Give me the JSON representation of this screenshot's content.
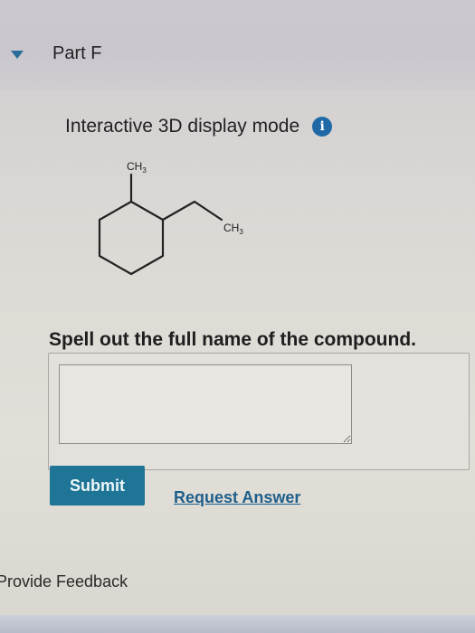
{
  "part": {
    "toggle_icon": "triangle-down-icon",
    "title": "Part F"
  },
  "display_mode": {
    "label": "Interactive 3D display mode",
    "info_icon_glyph": "i"
  },
  "structure": {
    "label_top": "CH3",
    "label_right": "CH3"
  },
  "question": {
    "prompt": "Spell out the full name of the compound.",
    "answer_value": ""
  },
  "actions": {
    "submit_label": "Submit",
    "request_answer_label": "Request Answer"
  },
  "footer": {
    "feedback_label": "Provide Feedback"
  },
  "colors": {
    "accent": "#1e7596",
    "link": "#1f5f8b",
    "info": "#1f6aa6"
  }
}
